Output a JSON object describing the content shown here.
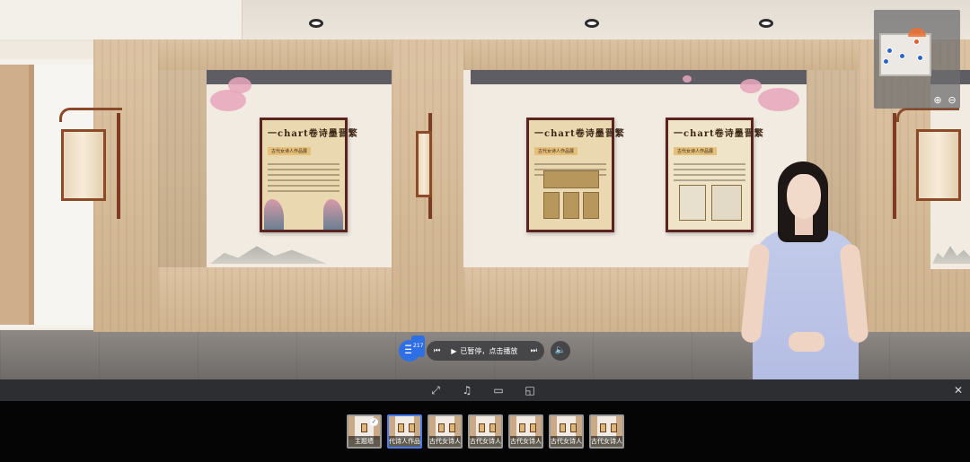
{
  "narration": {
    "menu_icon": "list-icon",
    "badge": "217",
    "status": "已暂停，点击播放",
    "prev_icon": "skip-back-icon",
    "play_icon": "play-icon",
    "next_icon": "skip-forward-icon",
    "volume_icon": "speaker-icon"
  },
  "toolbar": {
    "tools": [
      {
        "name": "fullscreen-icon",
        "glyph": "⤢"
      },
      {
        "name": "music-icon",
        "glyph": "♫"
      },
      {
        "name": "vr-icon",
        "glyph": "▭"
      },
      {
        "name": "note-icon",
        "glyph": "◱"
      }
    ],
    "close_glyph": "✕"
  },
  "scenes": [
    {
      "label": "主题墙",
      "active": false,
      "checked": true
    },
    {
      "label": "代诗人作品展",
      "active": true,
      "checked": false
    },
    {
      "label": "古代女诗人...",
      "active": false,
      "checked": false
    },
    {
      "label": "古代女诗人...",
      "active": false,
      "checked": false
    },
    {
      "label": "古代女诗人...",
      "active": false,
      "checked": false
    },
    {
      "label": "古代女诗人...",
      "active": false,
      "checked": false
    },
    {
      "label": "古代女诗人...",
      "active": false,
      "checked": false
    }
  ],
  "posters": [
    {
      "title": "一chart卷诗墨晋繁",
      "subtitle": "古代女诗人作品展"
    },
    {
      "title": "一chart卷诗墨晋繁",
      "subtitle": "古代女诗人作品展"
    },
    {
      "title": "一chart卷诗墨晋繁",
      "subtitle": "古代女诗人作品展"
    }
  ],
  "minimap": {
    "zoom_in": "⊕",
    "zoom_out": "⊖"
  },
  "colors": {
    "accent": "#2f6fe6",
    "poster_frame": "#5b2320"
  }
}
